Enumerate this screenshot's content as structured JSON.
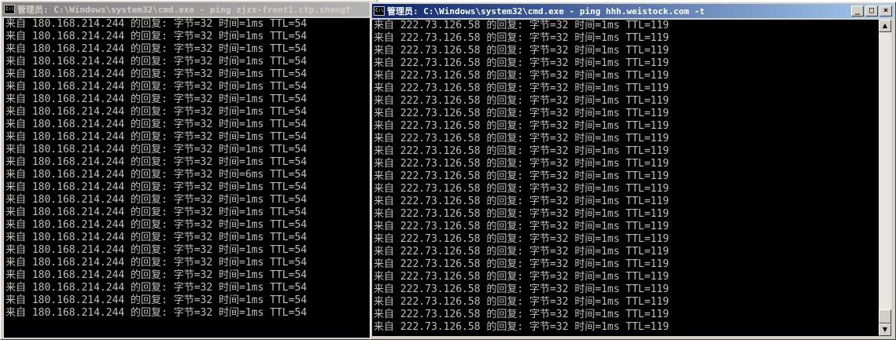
{
  "window_left": {
    "title": "管理员: C:\\Windows\\system32\\cmd.exe - ping  zjzx-front1.ctp.shengf",
    "icon": "cmd-icon",
    "lines": [
      "来自 180.168.214.244 的回复: 字节=32 时间=1ms TTL=54",
      "来自 180.168.214.244 的回复: 字节=32 时间=1ms TTL=54",
      "来自 180.168.214.244 的回复: 字节=32 时间=1ms TTL=54",
      "来自 180.168.214.244 的回复: 字节=32 时间=1ms TTL=54",
      "来自 180.168.214.244 的回复: 字节=32 时间=1ms TTL=54",
      "来自 180.168.214.244 的回复: 字节=32 时间=1ms TTL=54",
      "来自 180.168.214.244 的回复: 字节=32 时间=1ms TTL=54",
      "来自 180.168.214.244 的回复: 字节=32 时间=1ms TTL=54",
      "来自 180.168.214.244 的回复: 字节=32 时间=1ms TTL=54",
      "来自 180.168.214.244 的回复: 字节=32 时间=1ms TTL=54",
      "来自 180.168.214.244 的回复: 字节=32 时间=1ms TTL=54",
      "来自 180.168.214.244 的回复: 字节=32 时间=1ms TTL=54",
      "来自 180.168.214.244 的回复: 字节=32 时间=6ms TTL=54",
      "来自 180.168.214.244 的回复: 字节=32 时间=1ms TTL=54",
      "来自 180.168.214.244 的回复: 字节=32 时间=1ms TTL=54",
      "来自 180.168.214.244 的回复: 字节=32 时间=1ms TTL=54",
      "来自 180.168.214.244 的回复: 字节=32 时间=1ms TTL=54",
      "来自 180.168.214.244 的回复: 字节=32 时间=1ms TTL=54",
      "来自 180.168.214.244 的回复: 字节=32 时间=1ms TTL=54",
      "来自 180.168.214.244 的回复: 字节=32 时间=1ms TTL=54",
      "来自 180.168.214.244 的回复: 字节=32 时间=1ms TTL=54",
      "来自 180.168.214.244 的回复: 字节=32 时间=1ms TTL=54",
      "来自 180.168.214.244 的回复: 字节=32 时间=1ms TTL=54",
      "来自 180.168.214.244 的回复: 字节=32 时间=1ms TTL=54"
    ]
  },
  "window_right": {
    "title": "管理员: C:\\Windows\\system32\\cmd.exe - ping  hhh.weistock.com -t",
    "icon": "cmd-icon",
    "controls": {
      "minimize": "_",
      "maximize": "□",
      "close": "×"
    },
    "scrollbar": {
      "up": "▲",
      "down": "▼",
      "position": 1.0
    },
    "lines": [
      "来自 222.73.126.58 的回复: 字节=32 时间=1ms TTL=119",
      "来自 222.73.126.58 的回复: 字节=32 时间=1ms TTL=119",
      "来自 222.73.126.58 的回复: 字节=32 时间=1ms TTL=119",
      "来自 222.73.126.58 的回复: 字节=32 时间=1ms TTL=119",
      "来自 222.73.126.58 的回复: 字节=32 时间=1ms TTL=119",
      "来自 222.73.126.58 的回复: 字节=32 时间=1ms TTL=119",
      "来自 222.73.126.58 的回复: 字节=32 时间=1ms TTL=119",
      "来自 222.73.126.58 的回复: 字节=32 时间=1ms TTL=119",
      "来自 222.73.126.58 的回复: 字节=32 时间=1ms TTL=119",
      "来自 222.73.126.58 的回复: 字节=32 时间=1ms TTL=119",
      "来自 222.73.126.58 的回复: 字节=32 时间=1ms TTL=119",
      "来自 222.73.126.58 的回复: 字节=32 时间=1ms TTL=119",
      "来自 222.73.126.58 的回复: 字节=32 时间=1ms TTL=119",
      "来自 222.73.126.58 的回复: 字节=32 时间=1ms TTL=119",
      "来自 222.73.126.58 的回复: 字节=32 时间=1ms TTL=119",
      "来自 222.73.126.58 的回复: 字节=32 时间=1ms TTL=119",
      "来自 222.73.126.58 的回复: 字节=32 时间=1ms TTL=119",
      "来自 222.73.126.58 的回复: 字节=32 时间=1ms TTL=119",
      "来自 222.73.126.58 的回复: 字节=32 时间=1ms TTL=119",
      "来自 222.73.126.58 的回复: 字节=32 时间=1ms TTL=119",
      "来自 222.73.126.58 的回复: 字节=32 时间=1ms TTL=119",
      "来自 222.73.126.58 的回复: 字节=32 时间=1ms TTL=119",
      "来自 222.73.126.58 的回复: 字节=32 时间=1ms TTL=119",
      "来自 222.73.126.58 的回复: 字节=32 时间=1ms TTL=119",
      "来自 222.73.126.58 的回复: 字节=32 时间=1ms TTL=119"
    ]
  },
  "colors": {
    "console_bg": "#000000",
    "console_fg": "#c0c0c0",
    "active_title": "#0a246a",
    "inactive_title": "#808080",
    "chrome": "#d4d0c8"
  }
}
